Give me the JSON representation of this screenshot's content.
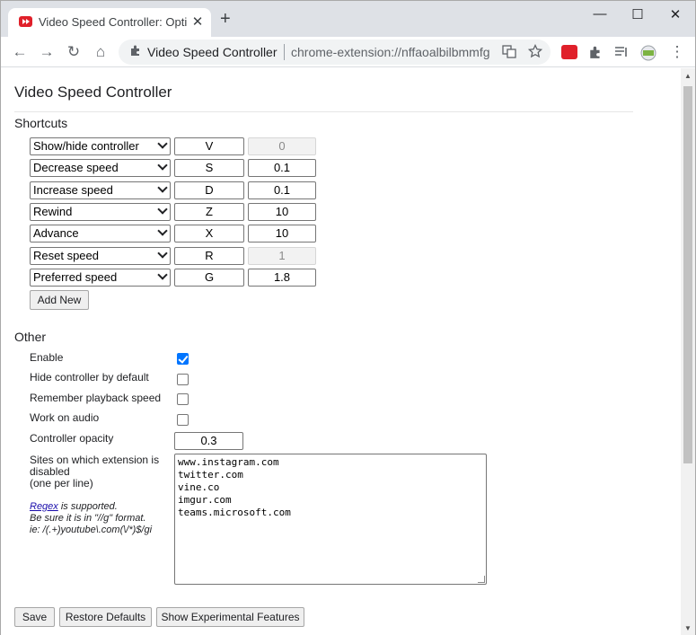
{
  "browser": {
    "tab_title": "Video Speed Controller: Options",
    "tab_close": "✕",
    "new_tab": "+",
    "window_controls": {
      "minimize": "—",
      "maximize": "☐",
      "close": "✕"
    },
    "nav": {
      "back": "←",
      "forward": "→",
      "reload": "↻",
      "home": "⌂"
    },
    "omnibox": {
      "extension_name": "Video Speed Controller",
      "url": "chrome-extension://nffaoalbilbmmfgbnbgppjihopabppdk"
    },
    "menu": "⋮"
  },
  "page": {
    "title": "Video Speed Controller",
    "shortcuts_heading": "Shortcuts",
    "shortcuts": [
      {
        "action": "Show/hide controller",
        "key": "V",
        "value": "0",
        "value_disabled": true
      },
      {
        "action": "Decrease speed",
        "key": "S",
        "value": "0.1",
        "value_disabled": false
      },
      {
        "action": "Increase speed",
        "key": "D",
        "value": "0.1",
        "value_disabled": false
      },
      {
        "action": "Rewind",
        "key": "Z",
        "value": "10",
        "value_disabled": false
      },
      {
        "action": "Advance",
        "key": "X",
        "value": "10",
        "value_disabled": false
      },
      {
        "action": "Reset speed",
        "key": "R",
        "value": "1",
        "value_disabled": true
      },
      {
        "action": "Preferred speed",
        "key": "G",
        "value": "1.8",
        "value_disabled": false
      }
    ],
    "add_new_label": "Add New",
    "other_heading": "Other",
    "options": {
      "enable": {
        "label": "Enable",
        "checked": true
      },
      "hide_controller": {
        "label": "Hide controller by default",
        "checked": false
      },
      "remember_speed": {
        "label": "Remember playback speed",
        "checked": false
      },
      "work_on_audio": {
        "label": "Work on audio",
        "checked": false
      },
      "controller_opacity": {
        "label": "Controller opacity",
        "value": "0.3"
      }
    },
    "sites": {
      "label_line1": "Sites on which extension is disabled",
      "label_line2": "(one per line)",
      "regex_link": "Regex",
      "regex_text": " is supported.",
      "regex_line2": "Be sure it is in \"//g\" format.",
      "regex_line3": "ie: /(.+)youtube\\.com(\\/*)$/gi",
      "value": "www.instagram.com\ntwitter.com\nvine.co\nimgur.com\nteams.microsoft.com"
    },
    "buttons": {
      "save": "Save",
      "restore": "Restore Defaults",
      "experimental": "Show Experimental Features"
    }
  }
}
